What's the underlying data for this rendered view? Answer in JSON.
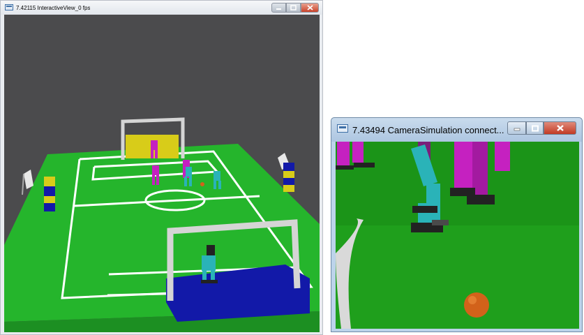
{
  "windows": {
    "interactive": {
      "title": "7.42115 InteractiveView_0 fps"
    },
    "camera": {
      "title": "7.43494 CameraSimulation connect..."
    }
  },
  "scene": {
    "field_color": "#25b52c",
    "field_line_color": "#ffffff",
    "goal_post_color": "#d5d5d5",
    "yellow_goal_color": "#d8cc19",
    "blue_goal_color": "#1219a8",
    "team_magenta_color": "#c521c0",
    "team_cyan_color": "#2ab3b8",
    "ball_color": "#d2621a",
    "background_color": "#4b4b4d"
  },
  "icons": {
    "app": "app-window-icon",
    "minimize": "minimize-icon",
    "maximize": "maximize-icon",
    "close": "close-icon"
  }
}
